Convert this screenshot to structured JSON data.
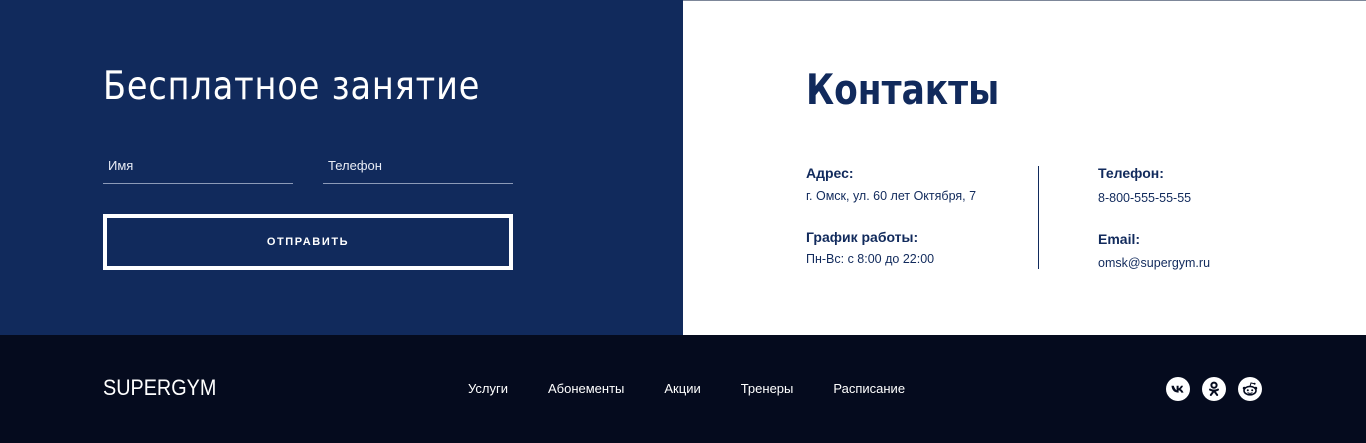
{
  "free_lesson": {
    "title": "Бесплатное занятие",
    "name_placeholder": "Имя",
    "phone_placeholder": "Телефон",
    "submit_label": "ОТПРАВИТЬ"
  },
  "contacts": {
    "title": "Контакты",
    "address_label": "Адрес:",
    "address_value": "г. Омск, ул. 60 лет Октября, 7",
    "hours_label": "График работы:",
    "hours_value": "Пн-Вс: с 8:00 до 22:00",
    "phone_label": "Телефон:",
    "phone_value": "8-800-555-55-55",
    "email_label": "Email:",
    "email_value": "omsk@supergym.ru"
  },
  "footer": {
    "logo": "SUPERGYM",
    "nav": [
      "Услуги",
      "Абонементы",
      "Акции",
      "Тренеры",
      "Расписание"
    ],
    "socials": [
      "vk-icon",
      "odnoklassniki-icon",
      "reddit-icon"
    ]
  },
  "colors": {
    "primary_blue": "#112a5c",
    "footer_bg": "#050b1e",
    "white": "#ffffff"
  }
}
